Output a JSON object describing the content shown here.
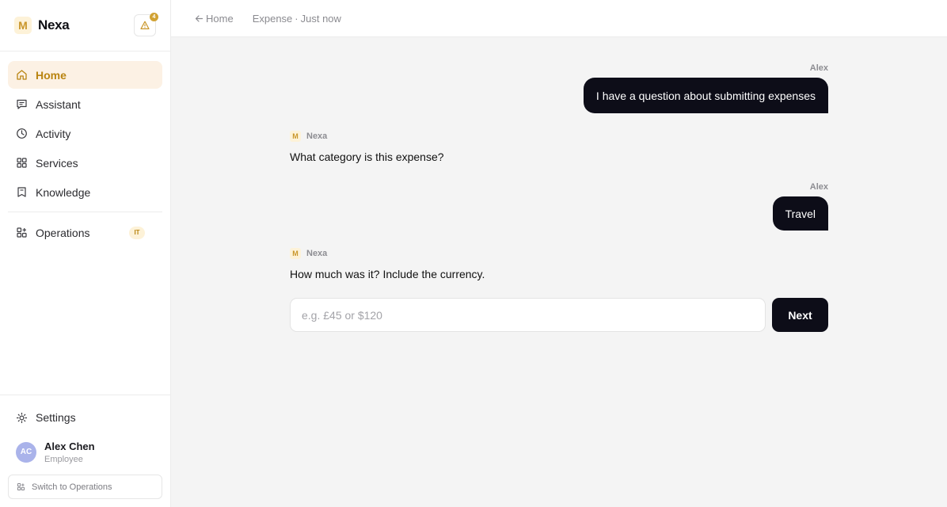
{
  "brand": {
    "logo_letter": "M",
    "name": "Nexa",
    "alert_count": "4",
    "accent": "#d1a234"
  },
  "nav": {
    "items": [
      {
        "label": "Home",
        "icon": "home-icon",
        "active": true
      },
      {
        "label": "Assistant",
        "icon": "chat-icon"
      },
      {
        "label": "Activity",
        "icon": "clock-icon"
      },
      {
        "label": "Services",
        "icon": "grid-icon"
      },
      {
        "label": "Knowledge",
        "icon": "book-icon"
      }
    ],
    "operations": {
      "label": "Operations",
      "icon": "apps-icon",
      "badge": "IT"
    }
  },
  "sidebar_bottom": {
    "settings_label": "Settings",
    "user": {
      "initials": "AC",
      "name": "Alex Chen",
      "role": "Employee"
    },
    "switch_label": "Switch to Operations"
  },
  "topbar": {
    "back_label": "Home",
    "crumb_title": "Expense",
    "crumb_sep": "·",
    "crumb_time": "Just now"
  },
  "chat": {
    "messages": [
      {
        "sender": "Alex",
        "text": "I have a question about submitting expenses"
      },
      {
        "sender": "Nexa",
        "text": "What category is this expense?"
      },
      {
        "sender": "Alex",
        "text": "Travel"
      },
      {
        "sender": "Nexa",
        "text": "How much was it? Include the currency."
      }
    ],
    "input": {
      "value": "",
      "placeholder": "e.g. £45 or $120"
    },
    "next_label": "Next"
  }
}
